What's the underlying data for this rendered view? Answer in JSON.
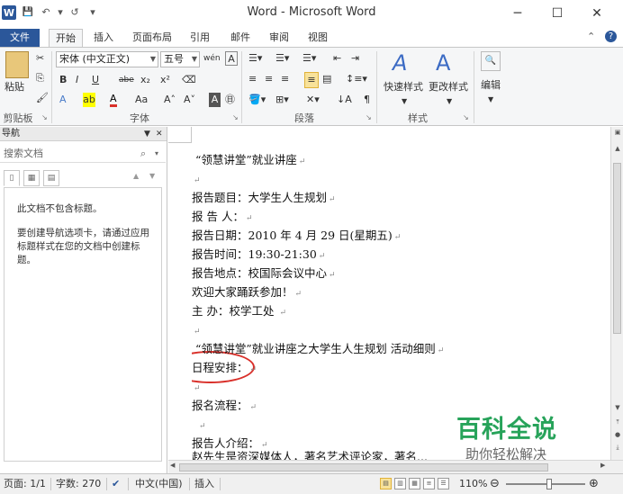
{
  "window": {
    "title": "Word - Microsoft Word",
    "app_icon_letter": "W",
    "controls": [
      "─",
      "☐",
      "✕"
    ]
  },
  "qat": {
    "save": "💾",
    "undo": "↶",
    "undo_dropdown": "▾",
    "redo": "↺",
    "customize": "▾"
  },
  "tabs": [
    {
      "label": "文件"
    },
    {
      "label": "开始"
    },
    {
      "label": "插入"
    },
    {
      "label": "页面布局"
    },
    {
      "label": "引用"
    },
    {
      "label": "邮件"
    },
    {
      "label": "审阅"
    },
    {
      "label": "视图"
    }
  ],
  "tab_help": {
    "minimize": "⌃",
    "help": "?"
  },
  "ribbon": {
    "groups": {
      "clipboard": "剪贴板",
      "font": "字体",
      "paragraph": "段落",
      "styles": "样式",
      "editing": ""
    },
    "paste": "粘贴",
    "font_name": "宋体 (中文正文)",
    "font_size": "五号",
    "wen": "wén",
    "quick_styles": "快速样式",
    "change_styles": "更改样式",
    "editing": "编辑",
    "bold": "B",
    "italic": "I",
    "underline": "U",
    "strike": "abe",
    "subscript": "x₂",
    "superscript": "x²",
    "grow_font": "A˄",
    "shrink_font": "A˅",
    "aa": "Aa",
    "paragraph_mark": "¶"
  },
  "nav": {
    "title": "导航",
    "search_placeholder": "搜索文档",
    "no_headings": "此文档不包含标题。",
    "hint": "要创建导航选项卡，请通过应用标题样式在您的文档中创建标题。"
  },
  "document": {
    "lines": [
      "“领慧讲堂”就业讲座",
      "",
      "报告题目：大学生人生规划",
      "报  告  人：",
      "报告日期：2010 年 4 月 29 日(星期五)",
      "报告时间：19:30-21:30",
      "报告地点：校国际会议中心",
      "欢迎大家踊跃参加！",
      "主  办：校学工处 ",
      "",
      "“领慧讲堂”就业讲座之大学生人生规划  活动细则",
      "日程安排：",
      "",
      "报名流程：",
      "",
      "报告人介绍：",
      "赵先生是资深媒体人，著名艺术评论家，著名..."
    ],
    "para_mark": "↵"
  },
  "watermark": {
    "big": "百科全说",
    "small": "助你轻松解决"
  },
  "status": {
    "page": "页面: 1/1",
    "words": "字数: 270",
    "lang": "中文(中国)",
    "insert": "插入",
    "zoom": "110%",
    "zoom_level": 0.55
  }
}
